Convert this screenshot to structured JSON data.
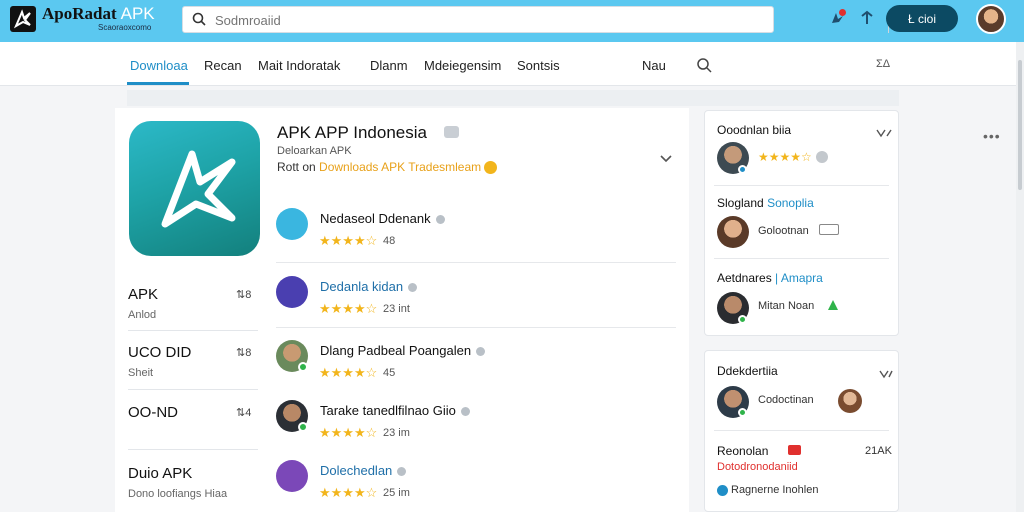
{
  "header": {
    "logo_name": "ApoRadat",
    "logo_apk": "APK",
    "logo_sub": "Scaoraoxcomo",
    "search_placeholder": "Sodmroaiid",
    "action_button": "Ł cioi"
  },
  "nav": {
    "tabs": [
      "Downloaa",
      "Recan",
      "Mait Indoratak",
      "Dlanm",
      "Mdeiegensim",
      "Sontsis"
    ],
    "right_label": "Nau",
    "far_right": "ΣΔ"
  },
  "app": {
    "title": "APK APP Indonesia",
    "subtitle": "Deloarkan APK",
    "rank_prefix": "Rott on",
    "rank_link": "Downloads APK Tradesmleam",
    "stats": [
      {
        "title": "APK",
        "sub": "Anlod",
        "num": "⇅8"
      },
      {
        "title": "UCO DID",
        "sub": "Sheit",
        "num": "⇅8"
      },
      {
        "title": "OO-ND",
        "sub": "",
        "num": "⇅4"
      },
      {
        "title": "Duio APK",
        "sub": "Dono loofiangs Hiaa",
        "num": ""
      }
    ]
  },
  "items": [
    {
      "name": "Nedaseol Ddenank",
      "stars": "★★★★☆",
      "count": "48"
    },
    {
      "name": "Dedanla kidan",
      "stars": "★★★★☆",
      "count": "23 int"
    },
    {
      "name": "Dlang Padbeal Poangalen",
      "stars": "★★★★☆",
      "count": "45"
    },
    {
      "name": "Tarake tanedlfilnao Giio",
      "stars": "★★★★☆",
      "count": "23 im"
    },
    {
      "name": "Dolechedlan",
      "stars": "★★★★☆",
      "count": "25 im"
    }
  ],
  "side_top": {
    "head1": "Ooodnlan biia",
    "head1_stars": "★★★★☆",
    "head2": "Slogland",
    "head2_link": "Sonoplia",
    "row2_text": "Golootnan",
    "head3": "Aetdnares",
    "head3_link": "| Amapra",
    "row3_text": "Mitan Noan"
  },
  "side_bottom": {
    "head1": "Ddekdertiia",
    "row1_text": "Codoctinan",
    "head2": "Reonolan",
    "head2_num": "21AK",
    "head2_sub": "Dotodronodaniid",
    "row3_text": "Ragnerne Inohlen"
  },
  "colors": {
    "header_bg": "#5bc8f0",
    "accent": "#1f8ec7",
    "star": "#f2b51c",
    "online": "#2fb34a"
  }
}
